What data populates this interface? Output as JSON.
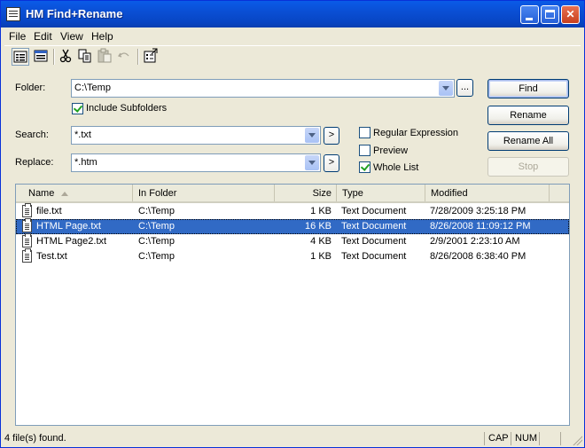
{
  "window": {
    "title": "HM Find+Rename"
  },
  "menu": {
    "items": [
      "File",
      "Edit",
      "View",
      "Help"
    ]
  },
  "toolbar": {
    "icons": [
      "details-view-icon",
      "list-view-icon",
      "cut-icon",
      "copy-icon",
      "paste-icon",
      "undo-icon",
      "properties-icon"
    ]
  },
  "form": {
    "folder_label": "Folder:",
    "folder_value": "C:\\Temp",
    "browse_label": "...",
    "include_subfolders_label": "Include Subfolders",
    "include_subfolders_checked": true,
    "search_label": "Search:",
    "search_value": "*.txt",
    "replace_label": "Replace:",
    "replace_value": "*.htm",
    "arrow_label": ">",
    "regex_label": "Regular Expression",
    "regex_checked": false,
    "preview_label": "Preview",
    "preview_checked": false,
    "whole_list_label": "Whole List",
    "whole_list_checked": true
  },
  "buttons": {
    "find": "Find",
    "rename": "Rename",
    "rename_all": "Rename All",
    "stop": "Stop"
  },
  "list": {
    "columns": [
      "Name",
      "In Folder",
      "Size",
      "Type",
      "Modified"
    ],
    "rows": [
      {
        "name": "file.txt",
        "folder": "C:\\Temp",
        "size": "1 KB",
        "type": "Text Document",
        "modified": "7/28/2009 3:25:18 PM",
        "selected": false
      },
      {
        "name": "HTML Page.txt",
        "folder": "C:\\Temp",
        "size": "16 KB",
        "type": "Text Document",
        "modified": "8/26/2008 11:09:12 PM",
        "selected": true
      },
      {
        "name": "HTML Page2.txt",
        "folder": "C:\\Temp",
        "size": "4 KB",
        "type": "Text Document",
        "modified": "2/9/2001 2:23:10 AM",
        "selected": false
      },
      {
        "name": "Test.txt",
        "folder": "C:\\Temp",
        "size": "1 KB",
        "type": "Text Document",
        "modified": "8/26/2008 6:38:40 PM",
        "selected": false
      }
    ]
  },
  "status": {
    "message": "4 file(s) found.",
    "cap": "CAP",
    "num": "NUM"
  }
}
